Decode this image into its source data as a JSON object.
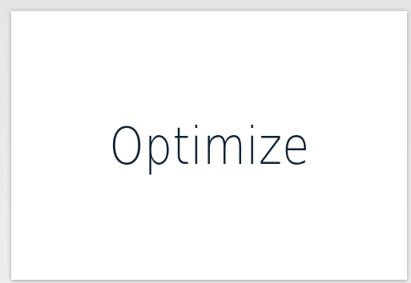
{
  "card": {
    "title": "Optimize"
  },
  "colors": {
    "text": "#0f2236",
    "card_background": "#ffffff",
    "page_background": "#ececec"
  }
}
